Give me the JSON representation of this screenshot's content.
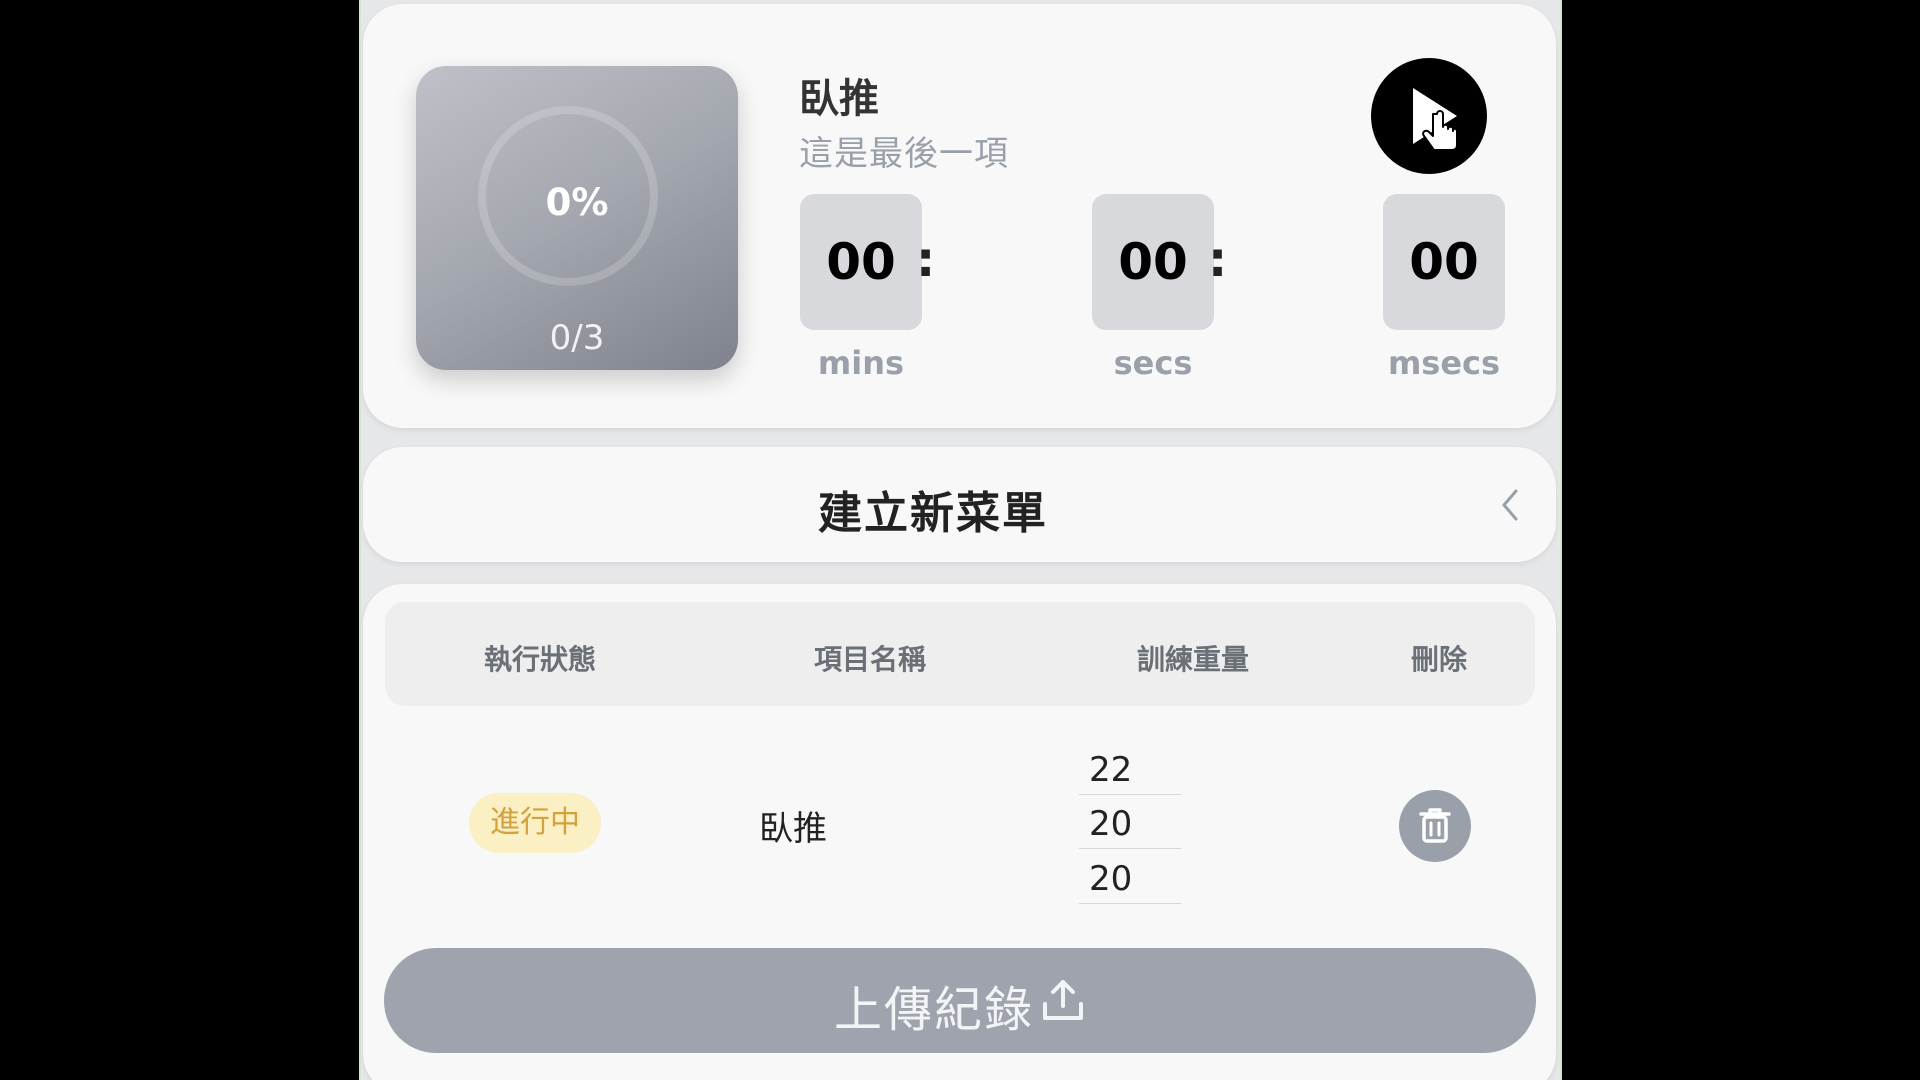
{
  "timer": {
    "progress_percent_label": "0%",
    "progress_percent": 0,
    "progress_count": "0/3",
    "exercise_name": "臥推",
    "exercise_note": "這是最後一項",
    "play_icon": "play-icon",
    "minutes": "00",
    "seconds": "00",
    "milliseconds": "00",
    "minutes_label": "mins",
    "seconds_label": "secs",
    "milliseconds_label": "msecs",
    "separator": ":"
  },
  "menu": {
    "title": "建立新菜單",
    "chevron_icon": "chevron-left-icon"
  },
  "table": {
    "headers": {
      "status": "執行狀態",
      "name": "項目名稱",
      "weight": "訓練重量",
      "delete": "刪除"
    },
    "rows": [
      {
        "status": "進行中",
        "name": "臥推",
        "weights": [
          "22",
          "20",
          "20"
        ],
        "delete_icon": "trash-icon"
      }
    ]
  },
  "upload": {
    "label": "上傳紀錄",
    "icon": "upload-icon"
  },
  "colors": {
    "app_background": "#e6e7e9",
    "card_background": "#f8f8f8",
    "status_badge_bg": "#fbefc4",
    "status_badge_text": "#d3a23e",
    "upload_button": "#9ea3ad",
    "delete_button": "#9aa0aa"
  }
}
